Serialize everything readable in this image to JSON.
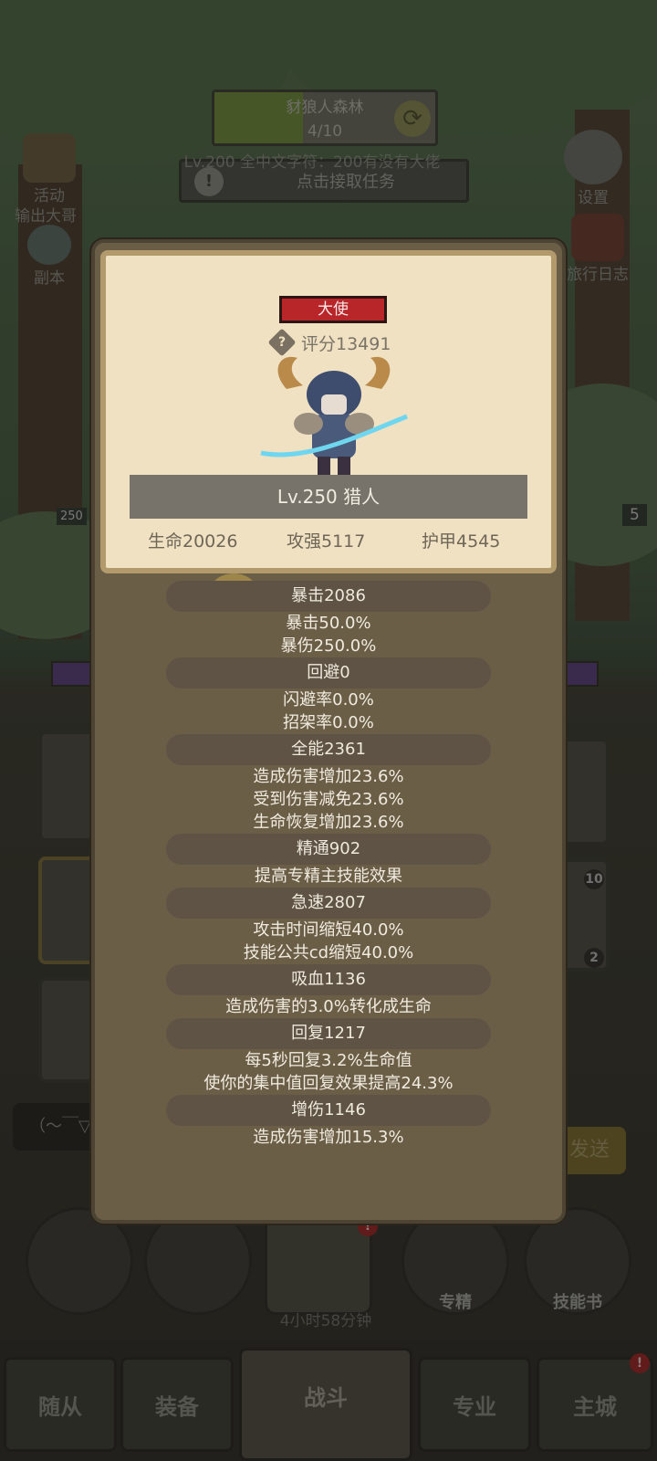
{
  "background": {
    "quest": {
      "title": "豺狼人森林",
      "progress_text": "4/10",
      "progress": 0.4
    },
    "marquee": "Lv.200 全中文字符：200有没有大佬",
    "task_label": "点击接取任务",
    "left_buttons": [
      {
        "label": "活动",
        "icon": "scroll-icon"
      },
      {
        "label": "输出大哥",
        "icon": ""
      },
      {
        "label": "副本",
        "icon": "portal-icon"
      }
    ],
    "right_buttons": [
      {
        "label": "设置",
        "icon": "gear-icon"
      },
      {
        "label": "旅行日志",
        "icon": "book-icon"
      }
    ],
    "level_tag_left": "250",
    "level_tag_right": "5",
    "slot_badges": [
      "10",
      "2"
    ],
    "chat_placeholder": "（～￣▽",
    "send_label": "发送",
    "timer": "4小时58分钟",
    "round_buttons": [
      {
        "label": "",
        "icon": "potion-icon"
      },
      {
        "label": "",
        "icon": "bread-icon"
      },
      {
        "label": "",
        "icon": "chest-icon"
      },
      {
        "label": "专精",
        "icon": "target-icon"
      },
      {
        "label": "技能书",
        "icon": "skillbook-icon"
      }
    ],
    "nav_tabs": [
      "随从",
      "装备",
      "战斗",
      "专业",
      "主城"
    ],
    "active_tab": "战斗"
  },
  "popup": {
    "title": "大使",
    "score": "评分13491",
    "name": "Lv.250 猎人",
    "stats": {
      "hp": "生命20026",
      "attack": "攻强5117",
      "armor": "护甲4545"
    },
    "attributes": [
      {
        "head": "暴击2086",
        "lines": [
          "暴击50.0%",
          "暴伤250.0%"
        ]
      },
      {
        "head": "回避0",
        "lines": [
          "闪避率0.0%",
          "招架率0.0%"
        ]
      },
      {
        "head": "全能2361",
        "lines": [
          "造成伤害增加23.6%",
          "受到伤害减免23.6%",
          "生命恢复增加23.6%"
        ]
      },
      {
        "head": "精通902",
        "lines": [
          "提高专精主技能效果"
        ]
      },
      {
        "head": "急速2807",
        "lines": [
          "攻击时间缩短40.0%",
          "技能公共cd缩短40.0%"
        ]
      },
      {
        "head": "吸血1136",
        "lines": [
          "造成伤害的3.0%转化成生命"
        ]
      },
      {
        "head": "回复1217",
        "lines": [
          "每5秒回复3.2%生命值",
          "使你的集中值回复效果提高24.3%"
        ]
      },
      {
        "head": "增伤1146",
        "lines": [
          "造成伤害增加15.3%"
        ]
      }
    ]
  },
  "colors": {
    "title_badge": "#b8262a",
    "card": "#efe1c2",
    "panel": "#6b5e47",
    "attr_head": "#5e5344"
  }
}
